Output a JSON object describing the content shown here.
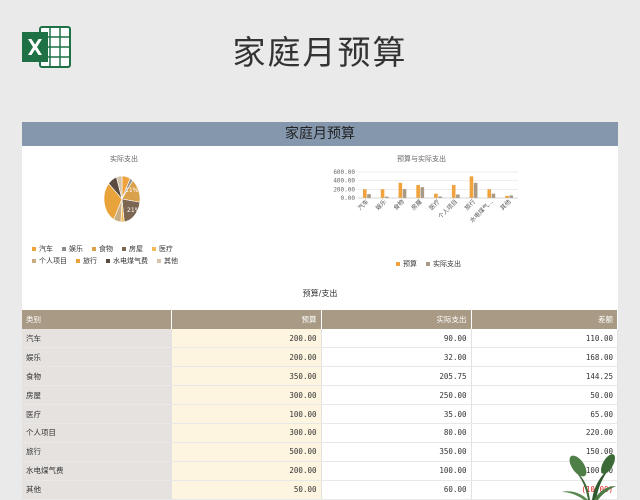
{
  "header": {
    "title": "家庭月预算",
    "app_icon": "excel-icon",
    "colors": {
      "excel_green": "#1e7145",
      "banner": "#8497ad",
      "table_header": "#a89a84"
    }
  },
  "sheet": {
    "banner_title": "家庭月预算",
    "section_title": "预算/支出"
  },
  "chart_data": [
    {
      "type": "pie",
      "title": "实际支出",
      "categories": [
        "汽车",
        "娱乐",
        "食物",
        "房屋",
        "医疗",
        "个人项目",
        "旅行",
        "水电煤气费",
        "其他"
      ],
      "values": [
        90.0,
        32.0,
        205.75,
        250.0,
        35.0,
        80.0,
        350.0,
        100.0,
        60.0
      ],
      "colors": [
        "#f0a33c",
        "#8c8c8c",
        "#d9a14c",
        "#7d6651",
        "#f6bb55",
        "#c9ac82",
        "#e8a33a",
        "#5b4b3e",
        "#d4c3a8"
      ],
      "data_labels": [
        "11%",
        "21%"
      ],
      "legend": "bottom"
    },
    {
      "type": "bar",
      "title": "预算与实际支出",
      "categories": [
        "汽车",
        "娱乐",
        "食物",
        "房屋",
        "医疗",
        "个人项目",
        "旅行",
        "水电煤气...",
        "其他"
      ],
      "series": [
        {
          "name": "预算",
          "values": [
            200.0,
            200.0,
            350.0,
            300.0,
            100.0,
            300.0,
            500.0,
            200.0,
            50.0
          ],
          "color": "#f0a33c"
        },
        {
          "name": "实际支出",
          "values": [
            90.0,
            32.0,
            205.75,
            250.0,
            35.0,
            80.0,
            350.0,
            100.0,
            60.0
          ],
          "color": "#a89a84"
        }
      ],
      "yticks": [
        "600.00",
        "400.00",
        "200.00",
        "0.00"
      ],
      "ylim": [
        0,
        600
      ],
      "grid": true,
      "legend": "bottom"
    }
  ],
  "table": {
    "columns": [
      "类别",
      "预算",
      "实际支出",
      "差额"
    ],
    "rows": [
      {
        "category": "汽车",
        "budget": "200.00",
        "actual": "90.00",
        "diff": "110.00",
        "negative": false
      },
      {
        "category": "娱乐",
        "budget": "200.00",
        "actual": "32.00",
        "diff": "168.00",
        "negative": false
      },
      {
        "category": "食物",
        "budget": "350.00",
        "actual": "205.75",
        "diff": "144.25",
        "negative": false
      },
      {
        "category": "房屋",
        "budget": "300.00",
        "actual": "250.00",
        "diff": "50.00",
        "negative": false
      },
      {
        "category": "医疗",
        "budget": "100.00",
        "actual": "35.00",
        "diff": "65.00",
        "negative": false
      },
      {
        "category": "个人项目",
        "budget": "300.00",
        "actual": "80.00",
        "diff": "220.00",
        "negative": false
      },
      {
        "category": "旅行",
        "budget": "500.00",
        "actual": "350.00",
        "diff": "150.00",
        "negative": false
      },
      {
        "category": "水电煤气费",
        "budget": "200.00",
        "actual": "100.00",
        "diff": "100.00",
        "negative": false
      },
      {
        "category": "其他",
        "budget": "50.00",
        "actual": "60.00",
        "diff": "(10.00)",
        "negative": true
      }
    ]
  },
  "decor": {
    "plant_icon": "plant-icon"
  }
}
